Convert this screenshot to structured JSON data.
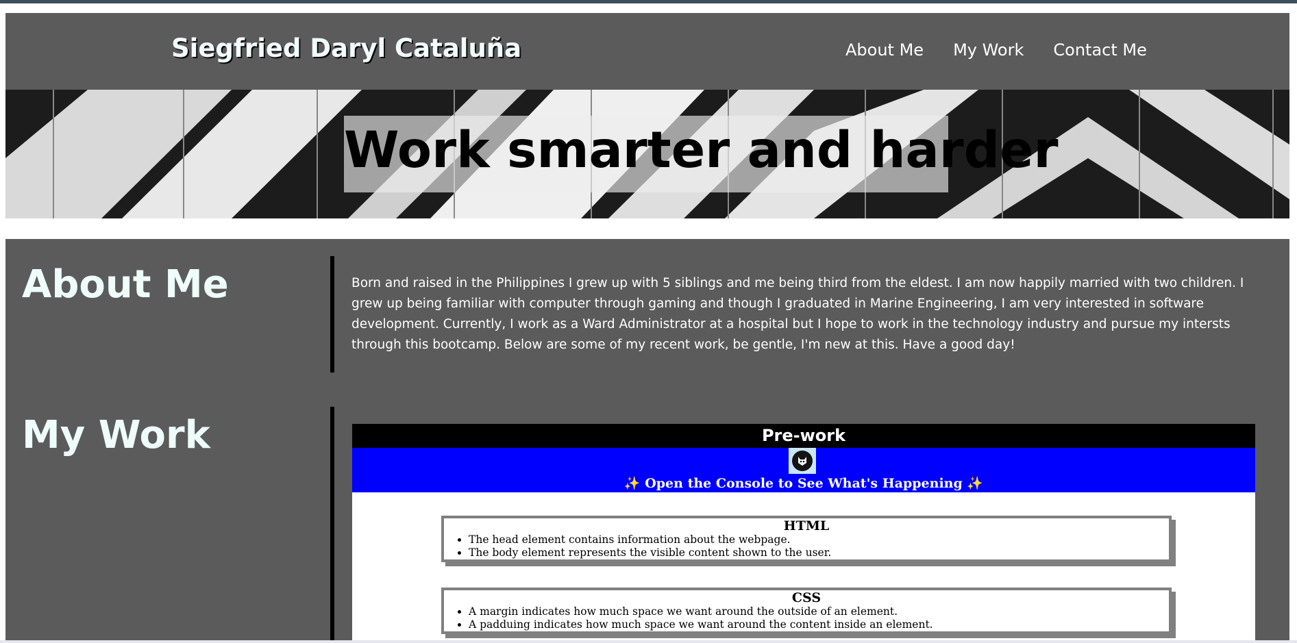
{
  "header": {
    "brand": "Siegfried Daryl Cataluña",
    "nav": [
      "About Me",
      "My Work",
      "Contact Me"
    ]
  },
  "hero": {
    "title": "Work smarter and harder"
  },
  "about": {
    "heading": "About Me",
    "text": "Born and raised in the Philippines I grew up with 5 siblings and me being third from the eldest. I am now happily married with two children. I grew up being familiar with computer through gaming and though I graduated in Marine Engineering, I am very interested in software development. Currently, I work as a Ward Administrator at a hospital but I hope to work in the technology industry and pursue my intersts through this bootcamp. Below are some of my recent work, be gentle, I'm new at this. Have a good day!"
  },
  "work": {
    "heading": "My Work",
    "card": {
      "title": "Pre-work",
      "banner_text": "Open the Console to See What's Happening",
      "sparkle": "✨",
      "topics": [
        {
          "title": "HTML",
          "items": [
            "The head element contains information about the webpage.",
            "The body element represents the visible content shown to the user."
          ]
        },
        {
          "title": "CSS",
          "items": [
            "A margin indicates how much space we want around the outside of an element.",
            "A padduing indicates how much space we want around the content inside an element."
          ]
        }
      ]
    }
  },
  "colors": {
    "header_bg": "#5b5b5b",
    "content_bg": "#5b5b5b",
    "card_banner": "#0000ff",
    "card_title_bg": "#000000",
    "heading_text": "#eefdf9"
  },
  "icons": {
    "avatar": "cat-avatar-icon",
    "sparkle": "sparkles-icon"
  }
}
